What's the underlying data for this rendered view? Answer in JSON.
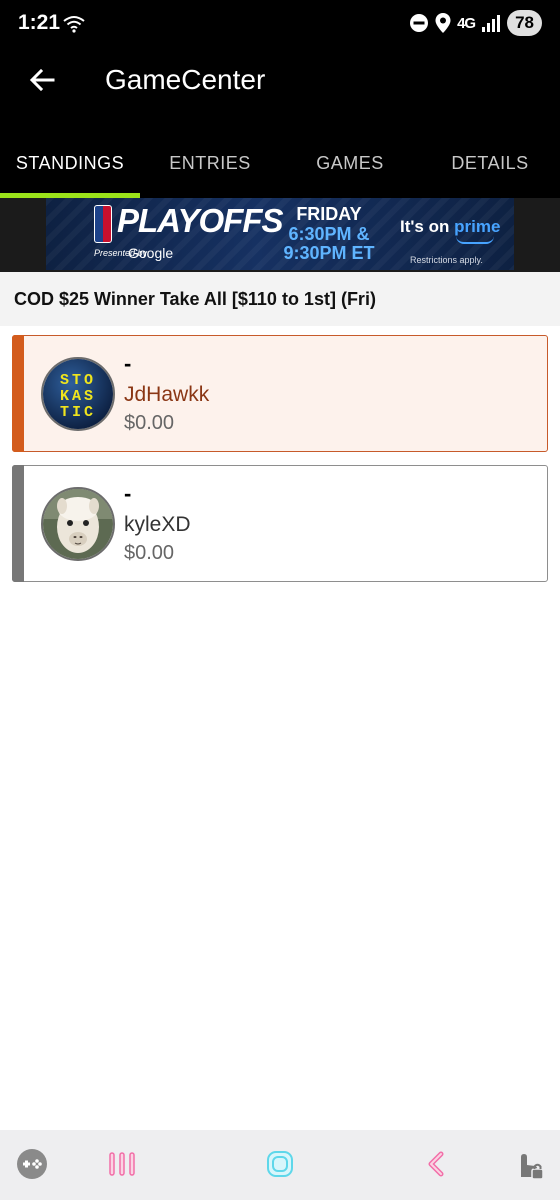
{
  "status_bar": {
    "time": "1:21",
    "network": "4G",
    "battery": "78",
    "icons": [
      "wifi-icon",
      "do-not-disturb-icon",
      "location-icon",
      "signal-icon"
    ]
  },
  "app_bar": {
    "title": "GameCenter",
    "back_icon": "arrow-left-icon"
  },
  "tabs": [
    {
      "label": "STANDINGS",
      "active": true
    },
    {
      "label": "ENTRIES",
      "active": false
    },
    {
      "label": "GAMES",
      "active": false
    },
    {
      "label": "DETAILS",
      "active": false
    }
  ],
  "ad": {
    "headline": "PLAYOFFS",
    "presented_by": "Presented by",
    "sponsor": "Google",
    "day": "FRIDAY",
    "time1": "6:30PM &",
    "time2": "9:30PM ET",
    "cta_prefix": "It's on ",
    "cta_brand": "prime",
    "disclaimer": "Restrictions apply."
  },
  "contest": {
    "title": "COD $25 Winner Take All [$110 to 1st] (Fri)"
  },
  "entries": [
    {
      "rank": "-",
      "name": "JdHawkk",
      "amount": "$0.00",
      "avatar_text": [
        "STO",
        "KAS",
        "TIC"
      ],
      "highlighted": true
    },
    {
      "rank": "-",
      "name": "kyleXD",
      "amount": "$0.00",
      "avatar": "alpaca-avatar",
      "highlighted": false
    }
  ],
  "colors": {
    "accent_green": "#9be21a",
    "highlight_orange": "#d35c1d",
    "highlight_bg": "#fdf2ec"
  },
  "nav_bar": {
    "icons": [
      "game-controller-icon",
      "recent-apps-icon",
      "home-icon",
      "back-icon",
      "touch-lock-icon"
    ]
  }
}
